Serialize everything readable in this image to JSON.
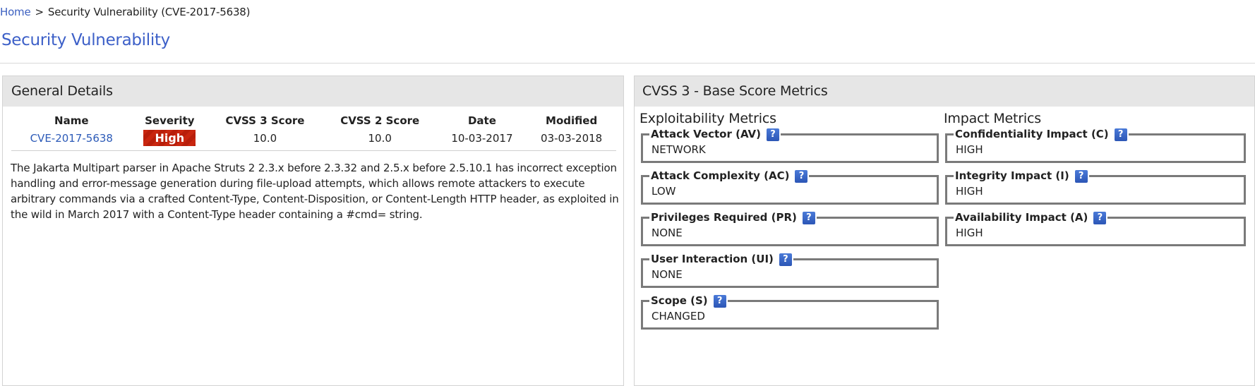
{
  "breadcrumb": {
    "home_label": "Home",
    "separator": ">",
    "current": "Security Vulnerability (CVE-2017-5638)"
  },
  "page_title": "Security Vulnerability",
  "general_details": {
    "title": "General Details",
    "columns": [
      "Name",
      "Severity",
      "CVSS 3 Score",
      "CVSS 2 Score",
      "Date",
      "Modified"
    ],
    "row": {
      "name": "CVE-2017-5638",
      "severity": "High",
      "cvss3_score": "10.0",
      "cvss2_score": "10.0",
      "date": "10-03-2017",
      "modified": "03-03-2018"
    },
    "description": "The Jakarta Multipart parser in Apache Struts 2 2.3.x before 2.3.32 and 2.5.x before 2.5.10.1 has incorrect exception handling and error-message generation during file-upload attempts, which allows remote attackers to execute arbitrary commands via a crafted Content-Type, Content-Disposition, or Content-Length HTTP header, as exploited in the wild in March 2017 with a Content-Type header containing a #cmd= string."
  },
  "cvss3": {
    "title": "CVSS 3 - Base Score Metrics",
    "help_icon_label": "?",
    "exploitability": {
      "title": "Exploitability Metrics",
      "metrics": [
        {
          "label": "Attack Vector (AV)",
          "value": "NETWORK"
        },
        {
          "label": "Attack Complexity (AC)",
          "value": "LOW"
        },
        {
          "label": "Privileges Required (PR)",
          "value": "NONE"
        },
        {
          "label": "User Interaction (UI)",
          "value": "NONE"
        },
        {
          "label": "Scope (S)",
          "value": "CHANGED"
        }
      ]
    },
    "impact": {
      "title": "Impact Metrics",
      "metrics": [
        {
          "label": "Confidentiality Impact (C)",
          "value": "HIGH"
        },
        {
          "label": "Integrity Impact (I)",
          "value": "HIGH"
        },
        {
          "label": "Availability Impact (A)",
          "value": "HIGH"
        }
      ]
    }
  },
  "colors": {
    "link": "#3b5fc0",
    "title": "#3d60c8",
    "severity_high": "#c9260f",
    "help_icon": "#2c56b6",
    "panel_header_bg": "#e6e6e6"
  }
}
